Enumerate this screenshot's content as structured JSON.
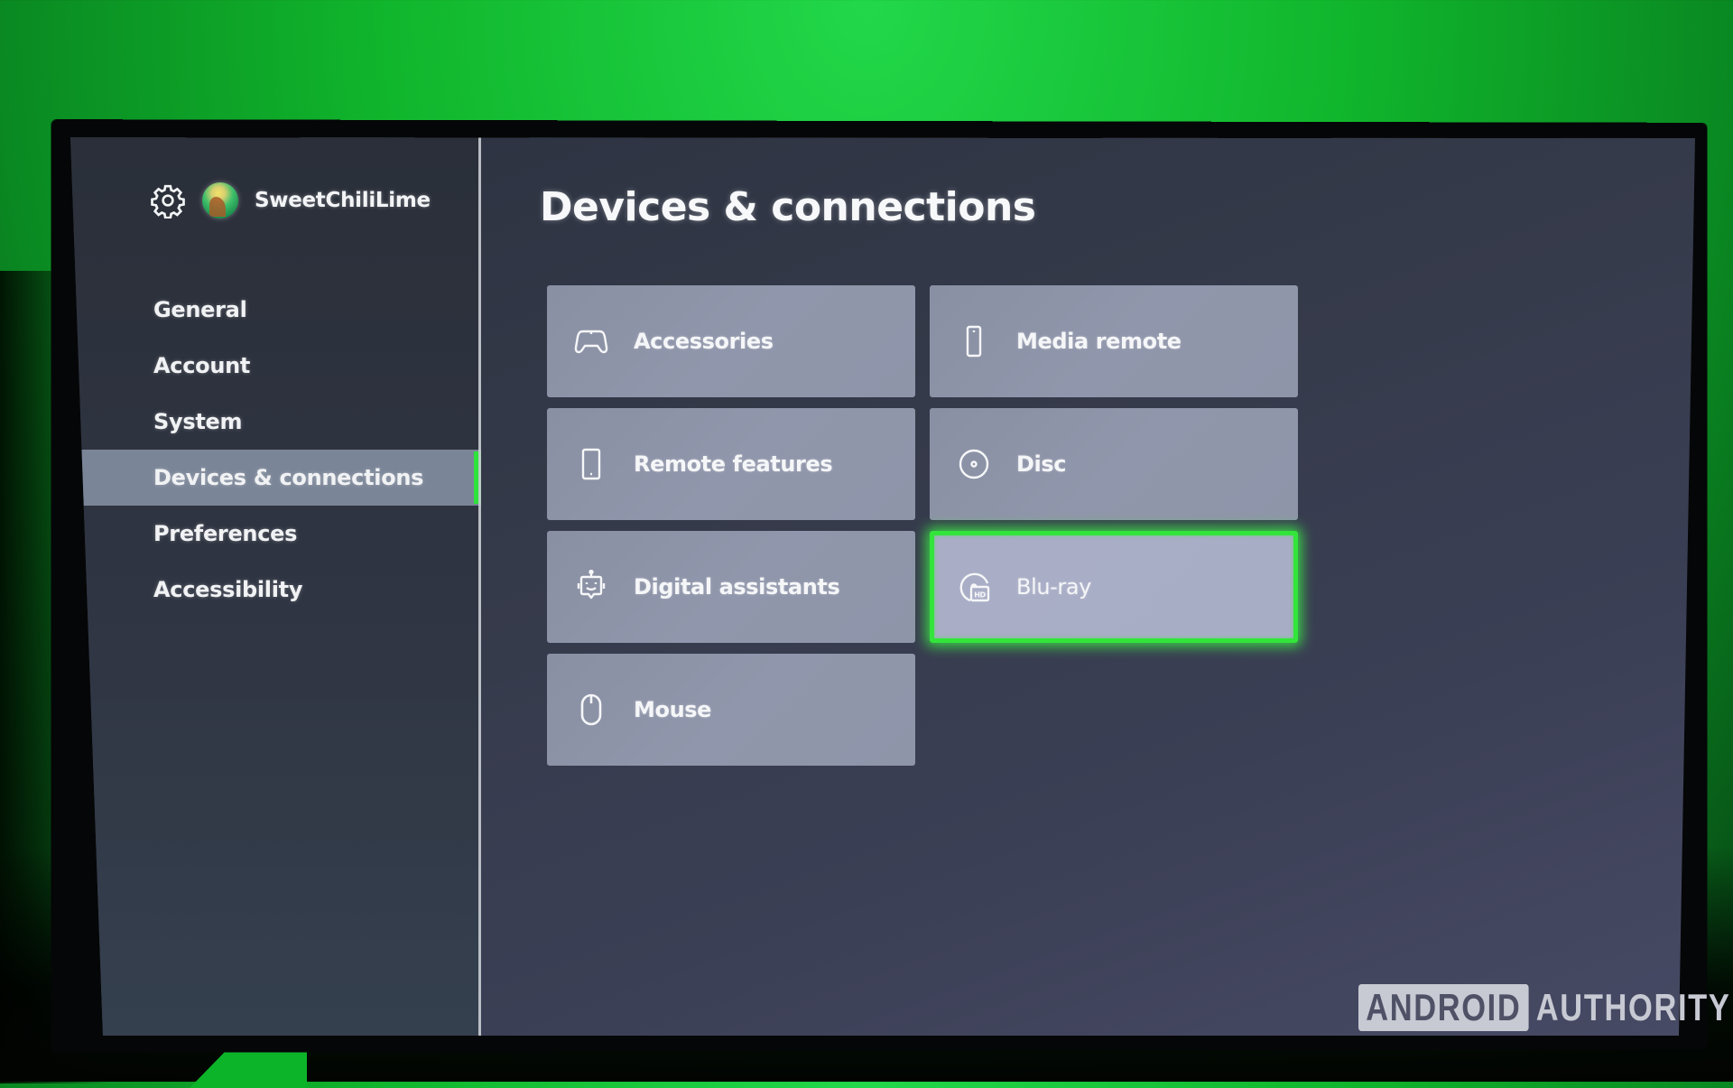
{
  "profile": {
    "settings_icon": "gear-icon",
    "avatar": "gamerpic-avatar",
    "gamertag": "SweetChiliLime"
  },
  "sidebar": {
    "items": [
      {
        "label": "General",
        "selected": false
      },
      {
        "label": "Account",
        "selected": false
      },
      {
        "label": "System",
        "selected": false
      },
      {
        "label": "Devices & connections",
        "selected": true
      },
      {
        "label": "Preferences",
        "selected": false
      },
      {
        "label": "Accessibility",
        "selected": false
      }
    ]
  },
  "main": {
    "title": "Devices & connections",
    "tiles": [
      {
        "label": "Accessories",
        "icon": "controller-icon",
        "focused": false
      },
      {
        "label": "Media remote",
        "icon": "remote-icon",
        "focused": false
      },
      {
        "label": "Remote features",
        "icon": "phone-icon",
        "focused": false
      },
      {
        "label": "Disc",
        "icon": "disc-icon",
        "focused": false
      },
      {
        "label": "Digital assistants",
        "icon": "assistant-bot-icon",
        "focused": false
      },
      {
        "label": "Blu-ray",
        "icon": "bluray-hd-icon",
        "focused": true
      },
      {
        "label": "Mouse",
        "icon": "mouse-icon",
        "focused": false
      }
    ]
  },
  "colors": {
    "accent": "#33e43b",
    "sidebar_selected": "#7a8597",
    "tile": "#8f95a9",
    "tile_focused": "#a9aec6"
  },
  "watermark": {
    "boxed": "ANDROID",
    "text": "AUTHORITY"
  }
}
